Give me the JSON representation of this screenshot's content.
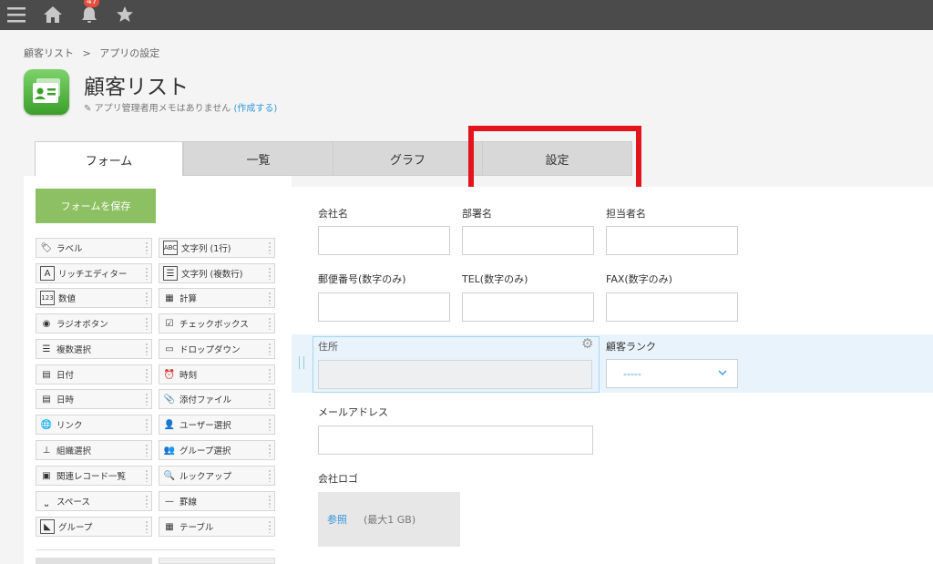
{
  "topbar": {
    "notification_count": "47"
  },
  "breadcrumb": {
    "app": "顧客リスト",
    "sep": ">",
    "page": "アプリの設定"
  },
  "app": {
    "title": "顧客リスト",
    "memo": "アプリ管理者用メモはありません",
    "memo_link": "(作成する)"
  },
  "tabs": [
    {
      "label": "フォーム"
    },
    {
      "label": "一覧"
    },
    {
      "label": "グラフ"
    },
    {
      "label": "設定"
    }
  ],
  "palette": {
    "save_label": "フォームを保存",
    "items": [
      {
        "label": "ラベル",
        "icon": "tag-icon"
      },
      {
        "label": "文字列 (1行)",
        "icon": "abc-icon"
      },
      {
        "label": "リッチエディター",
        "icon": "rich-text-icon"
      },
      {
        "label": "文字列 (複数行)",
        "icon": "multiline-icon"
      },
      {
        "label": "数値",
        "icon": "number-icon"
      },
      {
        "label": "計算",
        "icon": "calc-icon"
      },
      {
        "label": "ラジオボタン",
        "icon": "radio-icon"
      },
      {
        "label": "チェックボックス",
        "icon": "checkbox-icon"
      },
      {
        "label": "複数選択",
        "icon": "multiselect-icon"
      },
      {
        "label": "ドロップダウン",
        "icon": "dropdown-icon"
      },
      {
        "label": "日付",
        "icon": "calendar-icon"
      },
      {
        "label": "時刻",
        "icon": "clock-icon"
      },
      {
        "label": "日時",
        "icon": "datetime-icon"
      },
      {
        "label": "添付ファイル",
        "icon": "paperclip-icon"
      },
      {
        "label": "リンク",
        "icon": "globe-icon"
      },
      {
        "label": "ユーザー選択",
        "icon": "user-icon"
      },
      {
        "label": "組織選択",
        "icon": "org-icon"
      },
      {
        "label": "グループ選択",
        "icon": "group-icon"
      },
      {
        "label": "関連レコード一覧",
        "icon": "related-records-icon"
      },
      {
        "label": "ルックアップ",
        "icon": "lookup-icon"
      },
      {
        "label": "スペース",
        "icon": "space-icon"
      },
      {
        "label": "罫線",
        "icon": "line-icon"
      },
      {
        "label": "グループ",
        "icon": "group-field-icon"
      },
      {
        "label": "テーブル",
        "icon": "table-icon"
      }
    ]
  },
  "form": {
    "company": "会社名",
    "department": "部署名",
    "person": "担当者名",
    "zip": "郵便番号(数字のみ)",
    "tel": "TEL(数字のみ)",
    "fax": "FAX(数字のみ)",
    "address": "住所",
    "rank": "顧客ランク",
    "rank_value": "-----",
    "email": "メールアドレス",
    "logo": "会社ロゴ",
    "browse": "参照",
    "max_size": "(最大1 GB)"
  }
}
